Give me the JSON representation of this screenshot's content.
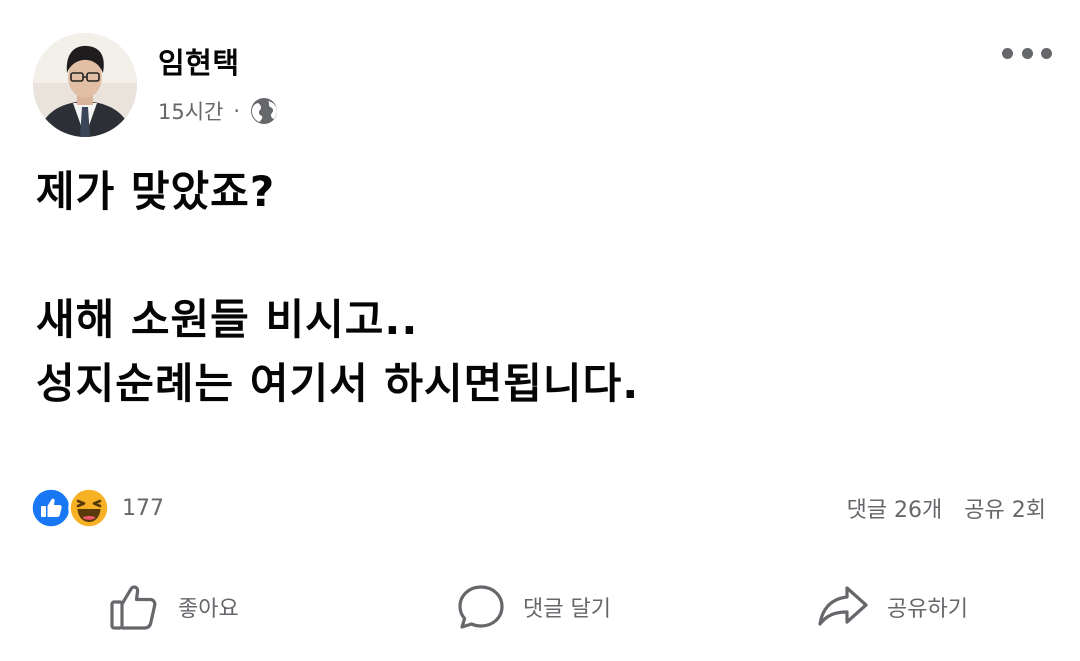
{
  "author": {
    "name": "임현택",
    "time": "15시간",
    "separator": "·",
    "privacy_icon": "globe-icon"
  },
  "menu": {
    "icon": "more-horizontal-icon"
  },
  "post": {
    "line1": "제가 맞았죠?",
    "line2": "새해 소원들 비시고..",
    "line3": "성지순례는 여기서 하시면됩니다."
  },
  "reactions": {
    "icons": [
      "like-reaction-icon",
      "haha-reaction-icon"
    ],
    "count": "177"
  },
  "stats": {
    "comments": "댓글 26개",
    "shares": "공유 2회"
  },
  "actions": {
    "like_label": "좋아요",
    "comment_label": "댓글 달기",
    "share_label": "공유하기"
  },
  "colors": {
    "text": "#050505",
    "secondary": "#65676b",
    "like_blue": "#1877f2",
    "haha_yellow": "#f7b125"
  }
}
